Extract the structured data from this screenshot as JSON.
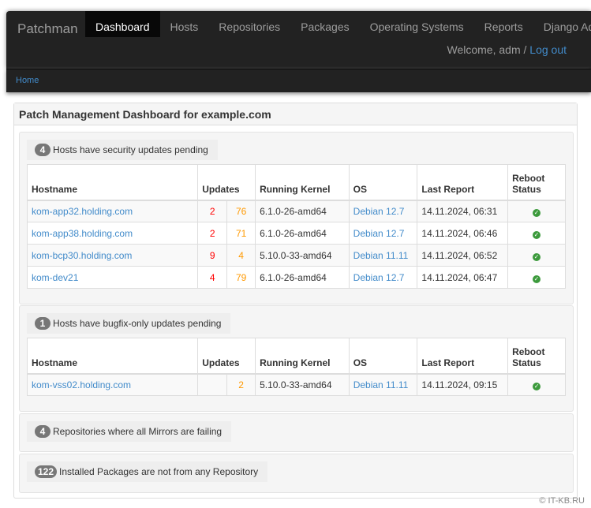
{
  "nav": {
    "brand": "Patchman",
    "items": [
      "Dashboard",
      "Hosts",
      "Repositories",
      "Packages",
      "Operating Systems",
      "Reports",
      "Django Admin"
    ],
    "active": "Dashboard",
    "welcome": "Welcome, adm / ",
    "logout": "Log out"
  },
  "breadcrumb": {
    "home": "Home"
  },
  "panel": {
    "title": "Patch Management Dashboard for example.com"
  },
  "columns": [
    "Hostname",
    "Updates",
    "Running Kernel",
    "OS",
    "Last Report",
    "Reboot Status"
  ],
  "security": {
    "count": "4",
    "label": "Hosts have security updates pending",
    "rows": [
      {
        "host": "kom-app32.holding.com",
        "sec": "2",
        "bug": "76",
        "kernel": "6.1.0-26-amd64",
        "os": "Debian 12.7",
        "report": "14.11.2024, 06:31",
        "reboot": "ok"
      },
      {
        "host": "kom-app38.holding.com",
        "sec": "2",
        "bug": "71",
        "kernel": "6.1.0-26-amd64",
        "os": "Debian 12.7",
        "report": "14.11.2024, 06:46",
        "reboot": "ok"
      },
      {
        "host": "kom-bcp30.holding.com",
        "sec": "9",
        "bug": "4",
        "kernel": "5.10.0-33-amd64",
        "os": "Debian 11.11",
        "report": "14.11.2024, 06:52",
        "reboot": "ok"
      },
      {
        "host": "kom-dev21",
        "sec": "4",
        "bug": "79",
        "kernel": "6.1.0-26-amd64",
        "os": "Debian 12.7",
        "report": "14.11.2024, 06:47",
        "reboot": "ok"
      }
    ]
  },
  "bugfix": {
    "count": "1",
    "label": "Hosts have bugfix-only updates pending",
    "rows": [
      {
        "host": "kom-vss02.holding.com",
        "sec": "",
        "bug": "2",
        "kernel": "5.10.0-33-amd64",
        "os": "Debian 11.11",
        "report": "14.11.2024, 09:15",
        "reboot": "ok"
      }
    ]
  },
  "repos": {
    "count": "4",
    "label": "Repositories where all Mirrors are failing"
  },
  "packages": {
    "count": "122",
    "label": "Installed Packages are not from any Repository"
  },
  "colors": {
    "security": "#ff0000",
    "bugfix": "#ff9900",
    "link": "#428bca",
    "ok": "#3c9a3c"
  },
  "watermark": "© IT-KB.RU"
}
